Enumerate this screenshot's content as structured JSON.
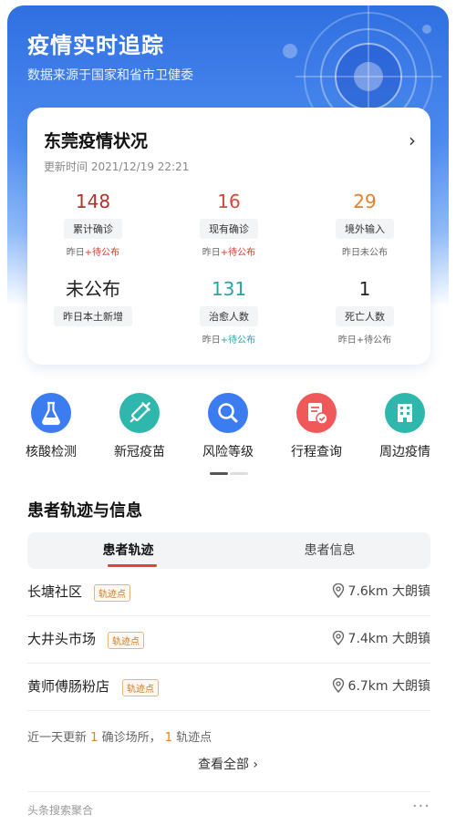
{
  "header": {
    "title": "疫情实时追踪",
    "subtitle": "数据来源于国家和省市卫健委"
  },
  "card": {
    "title": "东莞疫情状况",
    "update_time": "更新时间 2021/12/19 22:21",
    "stats": [
      {
        "value": "148",
        "label": "累计确诊",
        "note_prefix": "昨日",
        "note_highlight": "+待公布",
        "color": "#b5312a"
      },
      {
        "value": "16",
        "label": "现有确诊",
        "note_prefix": "昨日",
        "note_highlight": "+待公布",
        "color": "#d4483a"
      },
      {
        "value": "29",
        "label": "境外输入",
        "note_prefix": "昨日未公布",
        "note_highlight": "",
        "color": "#e5812a"
      },
      {
        "value": "未公布",
        "label": "昨日本土新增",
        "note_prefix": "",
        "note_highlight": "",
        "color": "#222222"
      },
      {
        "value": "131",
        "label": "治愈人数",
        "note_prefix": "昨日",
        "note_highlight": "+待公布",
        "color": "#28a5a5"
      },
      {
        "value": "1",
        "label": "死亡人数",
        "note_prefix": "昨日+待公布",
        "note_highlight": "",
        "color": "#222222"
      }
    ]
  },
  "shortcuts": [
    {
      "label": "核酸检测",
      "icon": "flask-icon",
      "color": "#3b7cf0"
    },
    {
      "label": "新冠疫苗",
      "icon": "syringe-icon",
      "color": "#2fb7ad"
    },
    {
      "label": "风险等级",
      "icon": "magnifier-icon",
      "color": "#3b7cf0"
    },
    {
      "label": "行程查询",
      "icon": "itinerary-icon",
      "color": "#f0595a"
    },
    {
      "label": "周边疫情",
      "icon": "building-icon",
      "color": "#2fb7ad"
    }
  ],
  "section": {
    "title": "患者轨迹与信息",
    "tabs": [
      "患者轨迹",
      "患者信息"
    ]
  },
  "locations": [
    {
      "name": "长塘社区",
      "tag": "轨迹点",
      "distance": "7.6km",
      "town": "大朗镇"
    },
    {
      "name": "大井头市场",
      "tag": "轨迹点",
      "distance": "7.4km",
      "town": "大朗镇"
    },
    {
      "name": "黄师傅肠粉店",
      "tag": "轨迹点",
      "distance": "6.7km",
      "town": "大朗镇"
    }
  ],
  "summary": {
    "prefix": "近一天更新",
    "count1": "1",
    "mid": "确诊场所，",
    "count2": "1",
    "suffix": "轨迹点"
  },
  "view_all": "查看全部",
  "footer": {
    "source": "头条搜索聚合",
    "more": "···"
  }
}
